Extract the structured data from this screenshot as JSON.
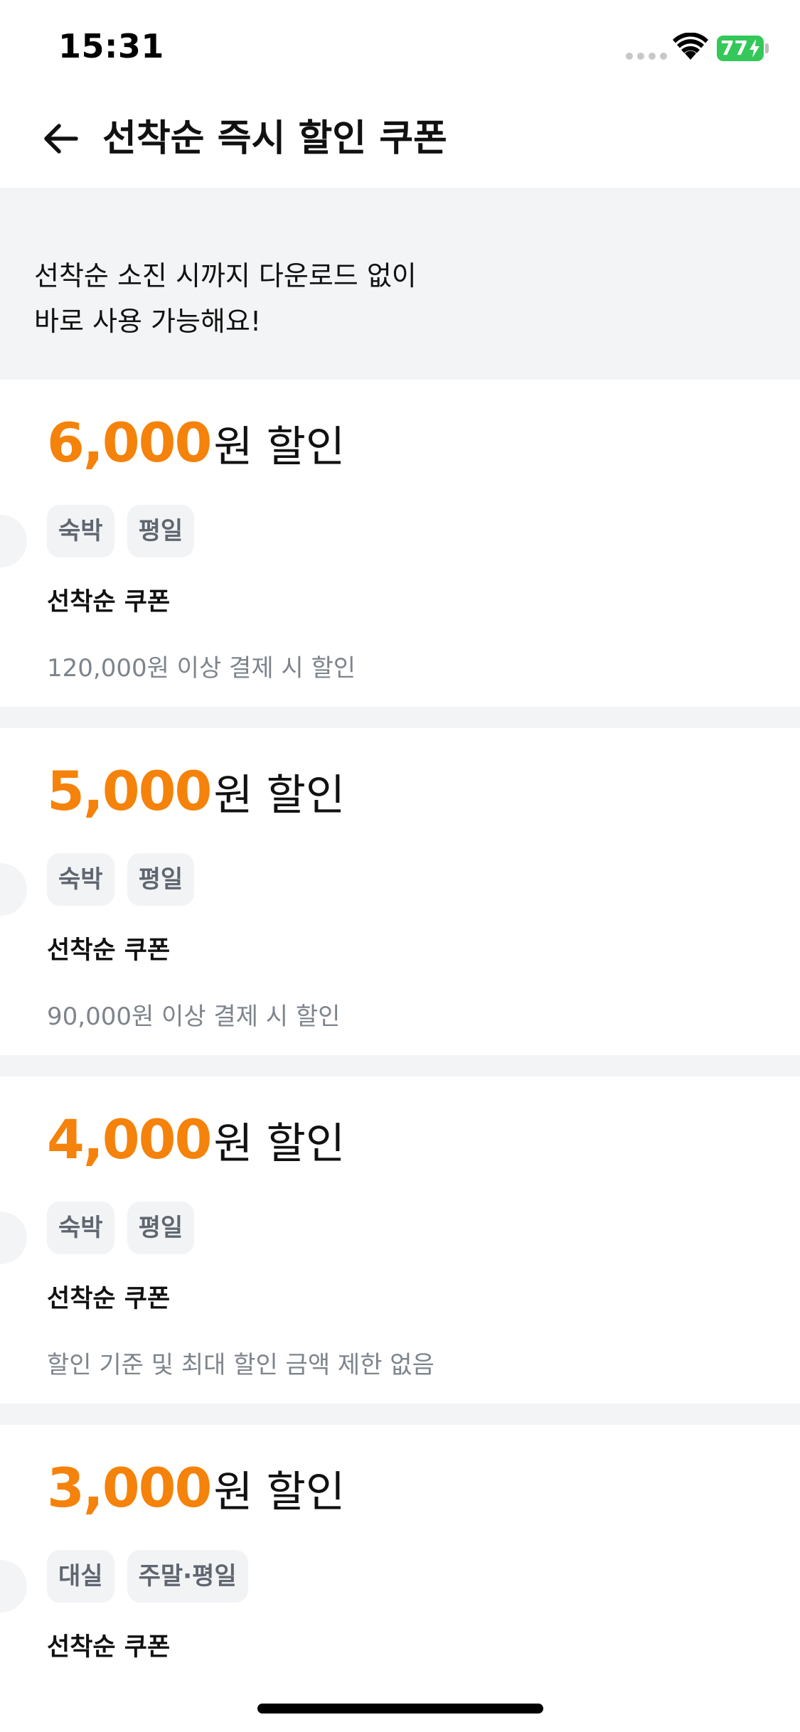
{
  "status_bar": {
    "time": "15:31",
    "battery_level": "77",
    "battery_color": "#34c759",
    "signal_icon": "cellular-signal-icon",
    "wifi_icon": "wifi-icon",
    "charging_icon": "charging-bolt-icon"
  },
  "header": {
    "title": "선착순 즉시 할인 쿠폰",
    "back_icon": "arrow-left-icon"
  },
  "banner": {
    "line1": "선착순 소진 시까지 다운로드 없이",
    "line2": "바로 사용 가능해요!"
  },
  "colors": {
    "accent": "#f5820a",
    "tag_text": "#5f6670",
    "muted_text": "#7d848c",
    "background_gray": "#f3f4f6"
  },
  "coupons": [
    {
      "amount": "6,000",
      "suffix": "원 할인",
      "tags": [
        "숙박",
        "평일"
      ],
      "name": "선착순 쿠폰",
      "condition": "120,000원 이상 결제 시 할인"
    },
    {
      "amount": "5,000",
      "suffix": "원 할인",
      "tags": [
        "숙박",
        "평일"
      ],
      "name": "선착순 쿠폰",
      "condition": "90,000원 이상 결제 시 할인"
    },
    {
      "amount": "4,000",
      "suffix": "원 할인",
      "tags": [
        "숙박",
        "평일"
      ],
      "name": "선착순 쿠폰",
      "condition": "할인 기준 및 최대 할인 금액 제한 없음"
    },
    {
      "amount": "3,000",
      "suffix": "원 할인",
      "tags": [
        "대실",
        "주말·평일"
      ],
      "name": "선착순 쿠폰",
      "condition": ""
    }
  ]
}
